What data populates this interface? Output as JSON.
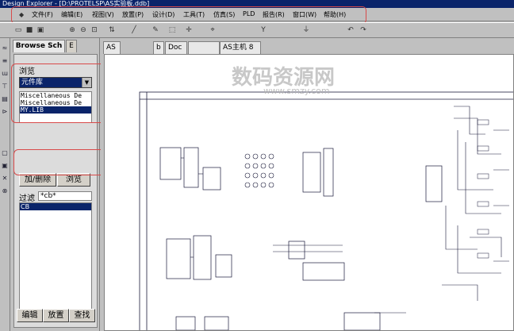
{
  "window": {
    "title": "Design Explorer - [D:\\PROTELSP\\AS实验板.ddb]"
  },
  "menubar": {
    "items": [
      "文件(F)",
      "编辑(E)",
      "视图(V)",
      "放置(P)",
      "设计(D)",
      "工具(T)",
      "仿真(S)",
      "PLD",
      "报告(R)",
      "窗口(W)",
      "帮助(H)"
    ]
  },
  "side_panel": {
    "tabs": [
      "Browse Sch",
      "E"
    ],
    "browse_label": "浏览",
    "browse_type": "元件库",
    "libraries": [
      "Miscellaneous De",
      "Miscellaneous De",
      "MY.LIB"
    ],
    "add_remove_button": "加/删除",
    "browse_button": "浏览",
    "filter_label": "过滤",
    "filter_value": "*cb*",
    "components": [
      "CB"
    ],
    "edit_button": "编辑",
    "place_button": "放置",
    "find_button": "查找"
  },
  "documents": {
    "tabs": [
      "AS",
      "b",
      "Doc",
      "",
      "AS主机 8 "
    ]
  },
  "watermark": {
    "text": "数码资源网",
    "url": "www.smzy.com"
  },
  "colors": {
    "selection": "#0a246a",
    "annotation": "#d84a4a",
    "schematic_line": "#1b1b3a"
  },
  "icons": {
    "toolbar": [
      "open-folder-icon",
      "save-icon",
      "print-icon",
      "zoom-in-icon",
      "zoom-out-icon",
      "zoom-fit-icon",
      "browse-icon",
      "wire-icon",
      "bus-icon",
      "select-icon",
      "move-icon",
      "cross-probe-icon",
      "part-icon",
      "power-icon",
      "undo-icon",
      "redo-icon"
    ],
    "left_tools": [
      "wire-tool-icon",
      "bus-tool-icon",
      "net-label-icon",
      "power-port-icon",
      "part-tool-icon",
      "sheet-symbol-icon",
      "port-icon",
      "junction-icon",
      "no-erc-icon",
      "probe-icon"
    ]
  }
}
